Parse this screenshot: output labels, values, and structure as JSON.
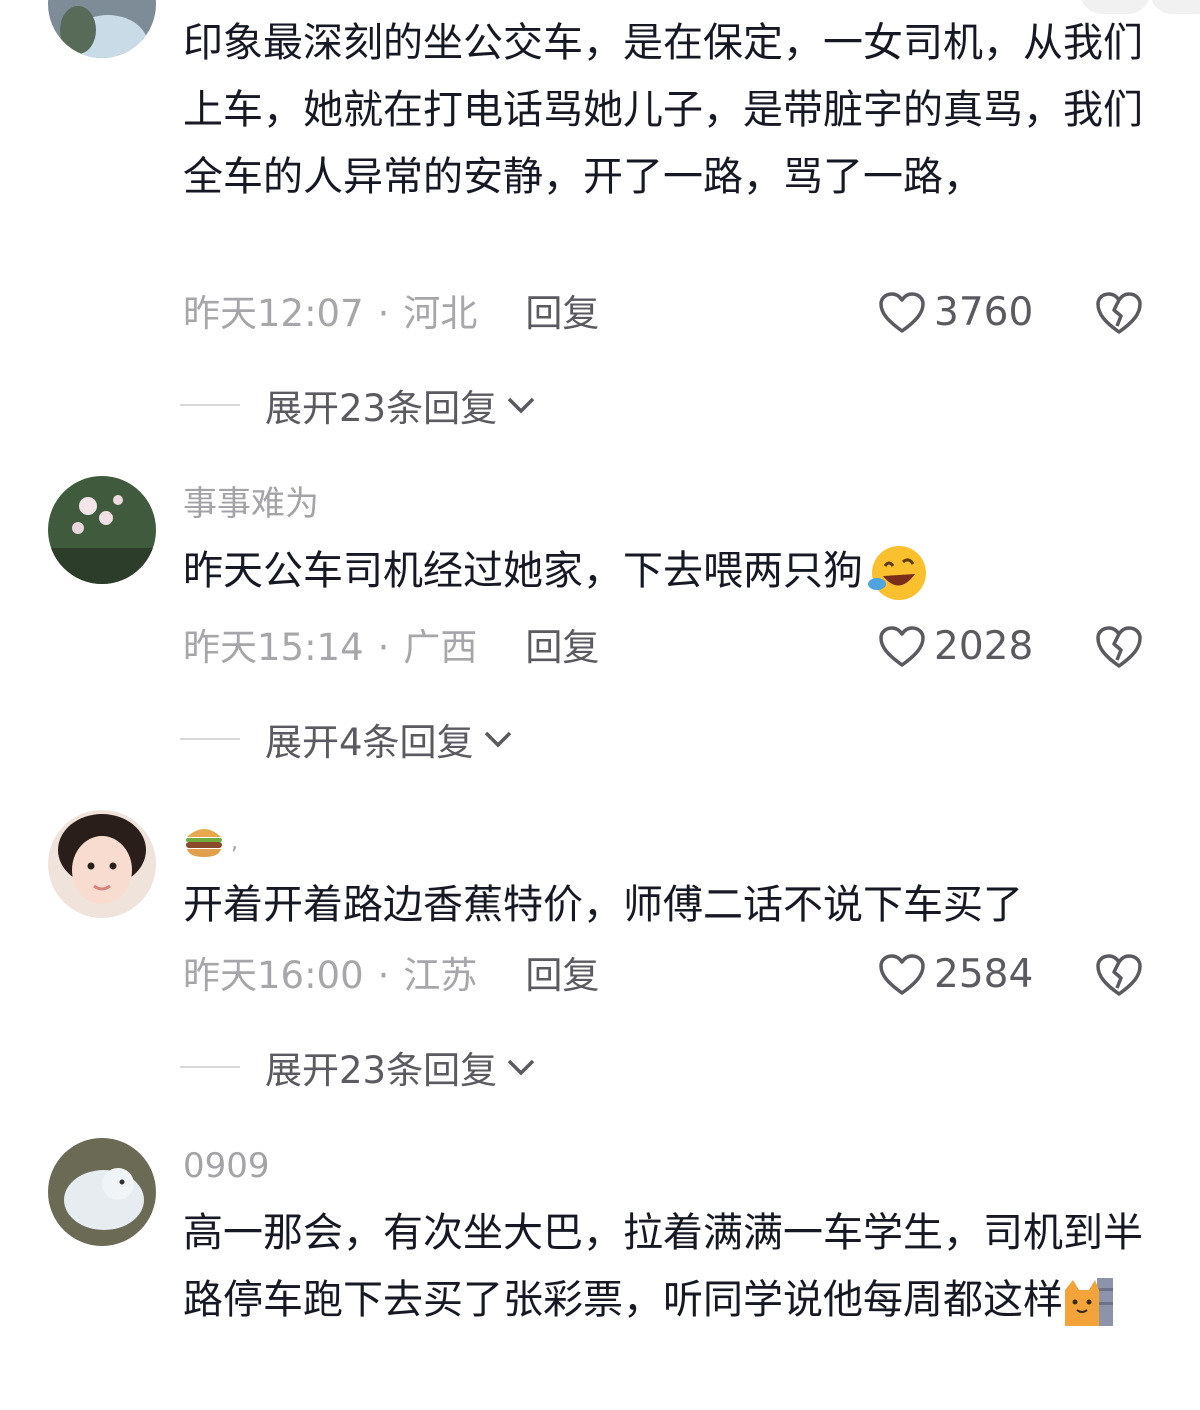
{
  "comments": [
    {
      "username": "",
      "text": "印象最深刻的坐公交车，是在保定，一女司机，从我们上车，她就在打电话骂她儿子，是带脏字的真骂，我们全车的人异常的安静，开了一路，骂了一路，",
      "time": "昨天12:07",
      "location": "河北",
      "reply_label": "回复",
      "likes": "3760",
      "expand_label": "展开23条回复"
    },
    {
      "username": "事事难为",
      "text": "昨天公车司机经过她家，下去喂两只狗",
      "text_emoji": "laughing-crying-emoji",
      "time": "昨天15:14",
      "location": "广西",
      "reply_label": "回复",
      "likes": "2028",
      "expand_label": "展开4条回复"
    },
    {
      "username_emoji": "hamburger-emoji",
      "username_tail": ",",
      "text": "开着开着路边香蕉特价，师傅二话不说下车买了",
      "time": "昨天16:00",
      "location": "江苏",
      "reply_label": "回复",
      "likes": "2584",
      "expand_label": "展开23条回复"
    },
    {
      "username": "0909",
      "text": "高一那会，有次坐大巴，拉着满满一车学生，司机到半路停车跑下去买了张彩票，听同学说他每周都这样",
      "text_emoji": "cat-peeking-emoji"
    }
  ],
  "dot": "·",
  "colors": {
    "text": "#161823",
    "meta": "#a7a7ab",
    "action": "#5a5a60"
  }
}
